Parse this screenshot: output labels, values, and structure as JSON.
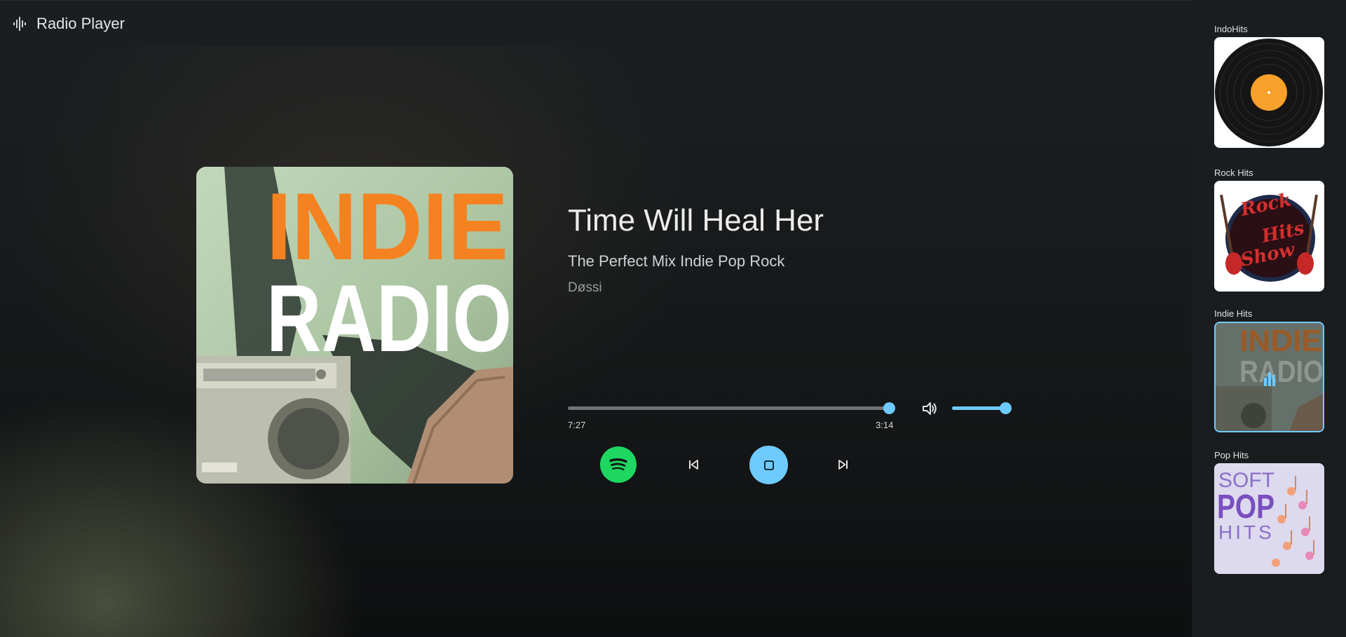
{
  "app": {
    "title": "Radio Player"
  },
  "now_playing": {
    "title": "Time Will Heal Her",
    "album": "The Perfect Mix Indie Pop Rock",
    "artist": "Døssi",
    "elapsed": "7:27",
    "duration": "3:14",
    "progress": 1.0,
    "volume": 0.9,
    "art_text": {
      "line1": "INDIE",
      "line2": "RADIO"
    }
  },
  "controls": {
    "spotify": "spotify-icon",
    "previous": "skip-previous-icon",
    "stop": "stop-icon",
    "next": "skip-next-icon",
    "volume": "volume-icon"
  },
  "stations": [
    {
      "name": "IndoHits",
      "art": "vinyl-record"
    },
    {
      "name": "Rock Hits",
      "art": "rock-hits-show"
    },
    {
      "name": "Indie Hits",
      "art": "indie-radio",
      "active": true
    },
    {
      "name": "Pop Hits",
      "art": "soft-pop-hits"
    }
  ],
  "colors": {
    "accent": "#6fcbff",
    "spotify": "#1ed760",
    "indie_orange": "#f58220"
  }
}
